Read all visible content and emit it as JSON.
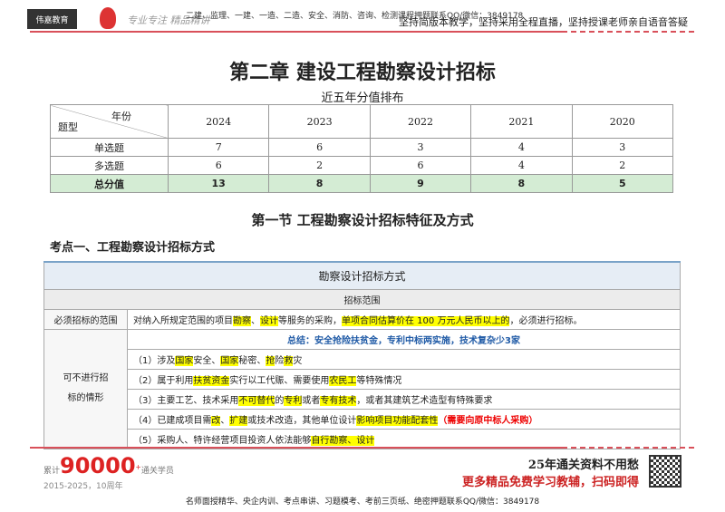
{
  "header": {
    "logo": "伟嘉教育",
    "signature": "专业专注 精品精讲",
    "links": "二建、监理、一建、一造、二造、安全、消防、咨询、检测课程押题联系QQ/微信：3849178",
    "slogan": "坚持简版本教学，坚持采用全程直播，坚持授课老师亲自语音答疑"
  },
  "title": "第二章  建设工程勘察设计招标",
  "subtitle": "近五年分值排布",
  "score_table": {
    "corner_top": "年份",
    "corner_bottom": "题型",
    "years": [
      "2024",
      "2023",
      "2022",
      "2021",
      "2020"
    ],
    "rows": [
      {
        "label": "单选题",
        "values": [
          "7",
          "6",
          "3",
          "4",
          "3"
        ]
      },
      {
        "label": "多选题",
        "values": [
          "6",
          "2",
          "6",
          "4",
          "2"
        ]
      },
      {
        "label": "总分值",
        "values": [
          "13",
          "8",
          "9",
          "8",
          "5"
        ]
      }
    ]
  },
  "section_title": "第一节  工程勘察设计招标特征及方式",
  "point_title": "考点一、工程勘察设计招标方式",
  "box": {
    "caption": "勘察设计招标方式",
    "range_header": "招标范围",
    "must_label": "必须招标的范围",
    "must": [
      "对纳入所规定范围的项目",
      "勘察",
      "、",
      "设计",
      "等服务的采购，",
      "单项合同估算价在 100 万元人民币以上的",
      "，必须进行招标。"
    ],
    "exempt_label": "可不进行招标的情形",
    "summary": "总结：安全抢险扶贫金，专利中标两实施，技术复杂少3家",
    "items": [
      [
        "（1）涉及",
        "国家",
        "安全、",
        "国家",
        "秘密、",
        "抢",
        "险",
        "救",
        "灾"
      ],
      [
        "（2）属于利用",
        "扶贫资金",
        "实行以工代赈、需要使用",
        "农民工",
        "等特殊情况"
      ],
      [
        "（3）主要工艺、技术采用",
        "不可替代",
        "的",
        "专利",
        "或者",
        "专有技术",
        "，或者其建筑艺术造型有特殊要求"
      ],
      [
        "（4）已建成项目需",
        "改",
        "、",
        "扩建",
        "或技术改造，其他单位设计",
        "影响项目功能配套性",
        "（需要向原中标人采购）"
      ],
      [
        "（5）采购人、特许经营项目投资人依法能够",
        "自行勘察、设计",
        ""
      ]
    ]
  },
  "footer": {
    "count_prefix": "累计",
    "count": "90000",
    "count_plus": "+",
    "count_suffix": "通关学员",
    "years": "2015-2025，10周年",
    "line1": "25年通关资料不用愁",
    "line2": "更多精品免费学习教辅，扫码即得",
    "bottom": "名师面授精华、央企内训、考点串讲、习题模考、考前三页纸、绝密押题联系QQ/微信：3849178"
  }
}
